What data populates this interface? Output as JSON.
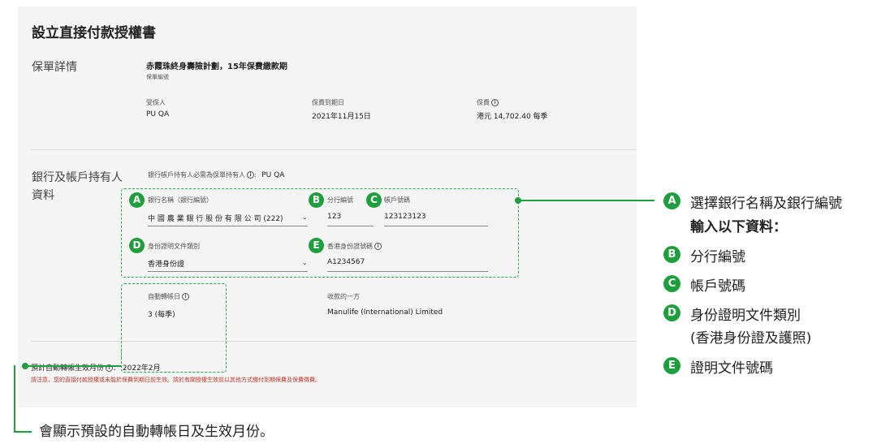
{
  "form": {
    "title": "設立直接付款授權書",
    "policy_section": {
      "heading": "保單詳情",
      "plan_name": "赤霞珠終身壽險計劃，15年保費繳款期",
      "policy_number_label": "保單編號",
      "insured_label": "受保人",
      "insured_value": "PU QA",
      "due_date_label": "保費到期日",
      "due_date_value": "2021年11月15日",
      "premium_label": "保費",
      "premium_value": "港元 14,702.40 每季"
    },
    "bank_section": {
      "heading": "銀行及帳戶持有人資料",
      "holder_note": "銀行帳戶持有人必需為保單持有人",
      "holder_value": "PU QA",
      "bank_name_label": "銀行名稱（銀行編號）",
      "bank_name_value": "中 國 農 業 銀 行 股 份 有 限 公 司 (222)",
      "branch_label": "分行編號",
      "branch_value": "123",
      "account_label": "帳戶號碼",
      "account_value": "123123123",
      "id_type_label": "身份證明文件類別",
      "id_type_value": "香港身份證",
      "id_number_label": "香港身份證號碼",
      "id_number_value": "A1234567",
      "auto_day_label": "自動轉帳日",
      "auto_day_value": "3 (每季)",
      "payee_label": "收款的一方",
      "payee_value": "Manulife (International) Limited"
    },
    "effective_month_label": "預計自動轉帳生效月份",
    "effective_month_value": "2022年2月",
    "warning": "請注意，您的直接付款授權或未能於保費到期日前生效。請於有關授權生效前以其他方式繳付到期保費及保費徵費。"
  },
  "badges": {
    "a": "A",
    "b": "B",
    "c": "C",
    "d": "D",
    "e": "E"
  },
  "legend": {
    "a_line1": "選擇銀行名稱及銀行編號",
    "a_line2": "輸入以下資料：",
    "b": "分行編號",
    "c": "帳戶號碼",
    "d_line1": "身份證明文件類別",
    "d_line2": "(香港身份證及護照)",
    "e": "證明文件號碼"
  },
  "footer_note": "會顯示預設的自動轉帳日及生效月份。",
  "icons": {
    "info": "info-icon",
    "dropdown": "chevron-down-icon"
  },
  "colors": {
    "accent_green": "#1f9e3e",
    "warning_red": "#c0392b",
    "card_bg": "#f5f5f5"
  }
}
